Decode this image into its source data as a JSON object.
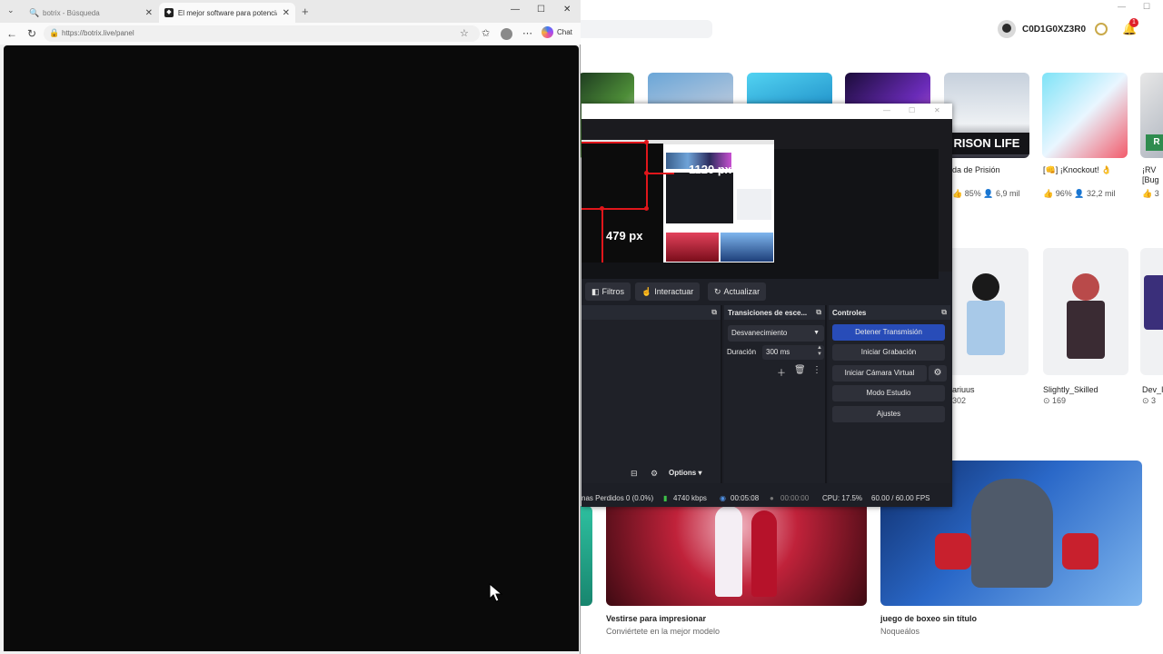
{
  "browser": {
    "tabs": [
      {
        "title": "botrix - Búsqueda",
        "icon": "search-icon",
        "active": false
      },
      {
        "title": "El mejor software para potenciar tu",
        "icon": "botrix-icon",
        "active": true
      }
    ],
    "url": "https://botrix.live/panel",
    "chat_label": "Chat"
  },
  "obs": {
    "preview": {
      "width_label": "1120 px",
      "height_label": "479 px"
    },
    "toolbar": {
      "filters": "Filtros",
      "interact": "Interactuar",
      "refresh": "Actualizar"
    },
    "transitions": {
      "title": "Transiciones de esce...",
      "selected": "Desvanecimiento",
      "duration_label": "Duración",
      "duration_value": "300 ms"
    },
    "controls": {
      "title": "Controles",
      "stop_stream": "Detener Transmisión",
      "start_recording": "Iniciar Grabación",
      "start_virtual_cam": "Iniciar Cámara Virtual",
      "studio_mode": "Modo Estudio",
      "settings": "Ajustes"
    },
    "scene_footer": {
      "options": "Options"
    },
    "status": {
      "dropped": "nas Perdidos 0 (0.0%)",
      "bitrate": "4740 kbps",
      "stream_time": "00:05:08",
      "rec_time": "00:00:00",
      "cpu": "CPU: 17.5%",
      "fps": "60.00 / 60.00 FPS"
    }
  },
  "roblox": {
    "username": "C0D1G0XZ3R0",
    "notification_count": "1",
    "games": [
      {
        "title": "da de Prisión",
        "like": "85%",
        "players": "6,9 mil",
        "thumb_text": "RISON LIFE"
      },
      {
        "title": "[👊] ¡Knockout! 👌",
        "like": "96%",
        "players": "32,2 mil"
      },
      {
        "title": "¡RV\n[Bug",
        "like": "3",
        "players": ""
      }
    ],
    "avatars": [
      {
        "name": "ariuus",
        "count": "302"
      },
      {
        "name": "Slightly_Skilled",
        "count": "169"
      },
      {
        "name": "Dev_I",
        "count": "3"
      }
    ],
    "featured": [
      {
        "title": "Vestirse para impresionar",
        "subtitle": "Conviértete en la mejor modelo"
      },
      {
        "title": "juego de boxeo sin título",
        "subtitle": "Noqueálos"
      }
    ]
  }
}
